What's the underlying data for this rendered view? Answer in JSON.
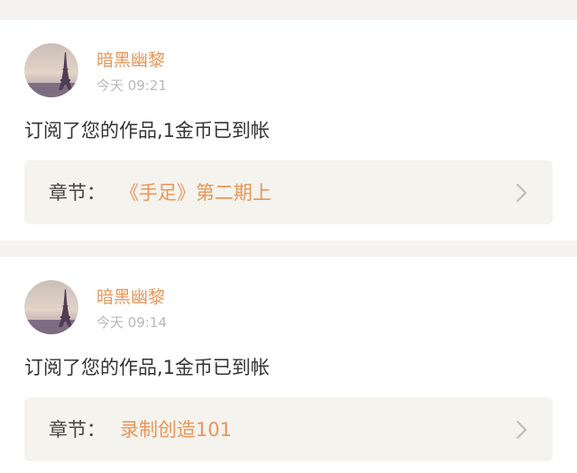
{
  "notifications": [
    {
      "username": "暗黑幽黎",
      "time": "今天 09:21",
      "message": "订阅了您的作品,1金币已到帐",
      "chapter_label": "章节：",
      "chapter_title": "《手足》第二期上"
    },
    {
      "username": "暗黑幽黎",
      "time": "今天 09:14",
      "message": "订阅了您的作品,1金币已到帐",
      "chapter_label": "章节：",
      "chapter_title": "录制创造101"
    }
  ],
  "colors": {
    "accent": "#e8965a",
    "page_background": "#f6f3f3",
    "card_background": "#ffffff",
    "chapter_background": "#f4f3ed",
    "timestamp": "#b8b8b8"
  },
  "icons": {
    "avatar": "eiffel-tower-avatar",
    "chevron": "chevron-right-icon"
  }
}
